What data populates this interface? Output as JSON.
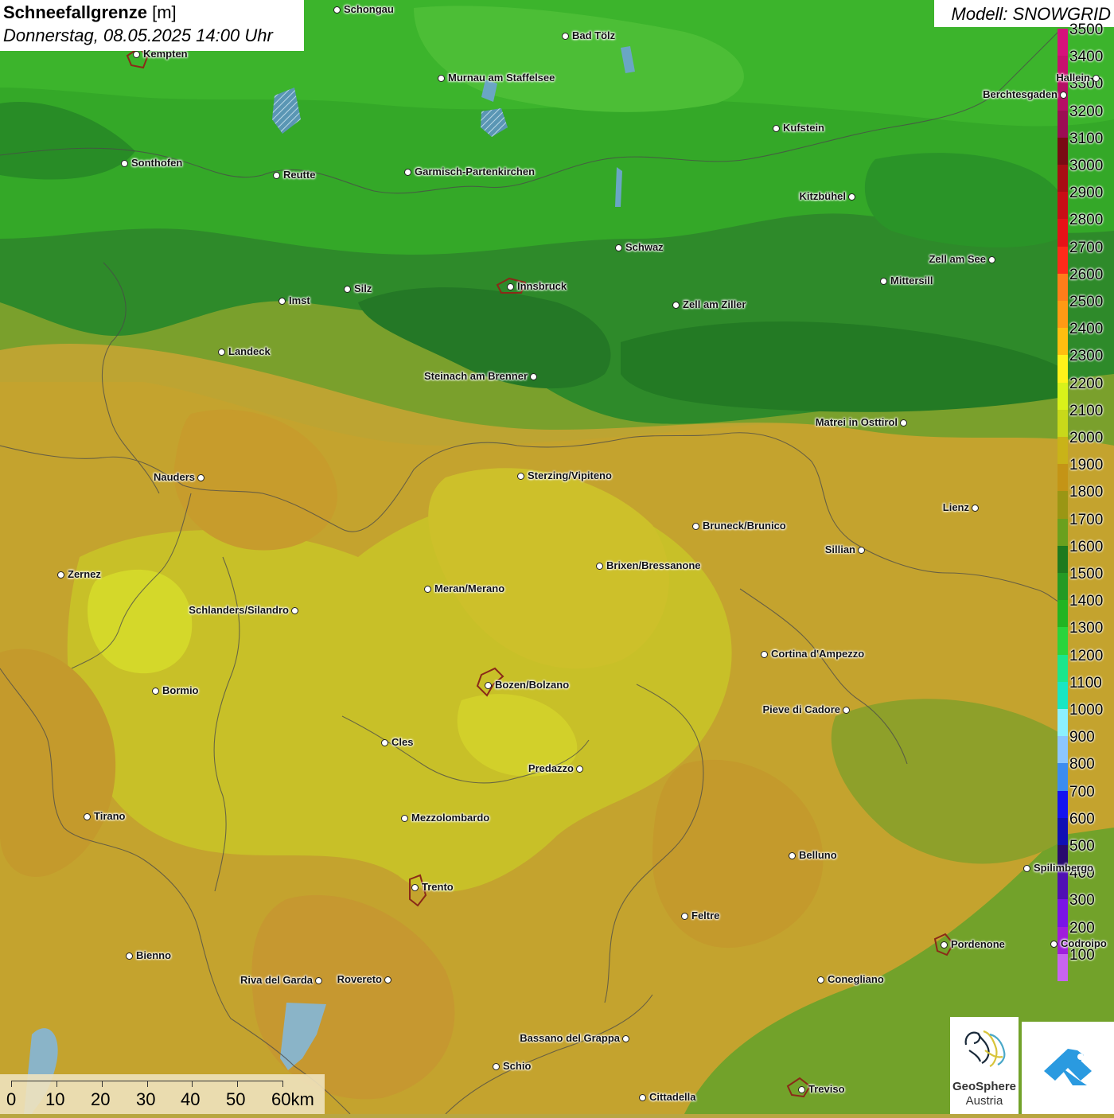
{
  "header": {
    "title": "Schneefallgrenze",
    "unit": "[m]",
    "datetime": "Donnerstag, 08.05.2025 14:00 Uhr",
    "model": "Modell: SNOWGRID"
  },
  "legend": [
    {
      "label": "3500",
      "color": "#d6127c"
    },
    {
      "label": "3400",
      "color": "#c7116f"
    },
    {
      "label": "3300",
      "color": "#b50f65"
    },
    {
      "label": "3200",
      "color": "#9c0d54"
    },
    {
      "label": "3100",
      "color": "#7a0a14"
    },
    {
      "label": "3000",
      "color": "#a80d14"
    },
    {
      "label": "2900",
      "color": "#c80e16"
    },
    {
      "label": "2800",
      "color": "#e61218"
    },
    {
      "label": "2700",
      "color": "#ff2a1a"
    },
    {
      "label": "2600",
      "color": "#ff7d1a"
    },
    {
      "label": "2500",
      "color": "#ff9a14"
    },
    {
      "label": "2400",
      "color": "#ffbe10"
    },
    {
      "label": "2300",
      "color": "#fff21a"
    },
    {
      "label": "2200",
      "color": "#d9f21a"
    },
    {
      "label": "2100",
      "color": "#c8d91a"
    },
    {
      "label": "2000",
      "color": "#c9b318"
    },
    {
      "label": "1900",
      "color": "#c49416"
    },
    {
      "label": "1800",
      "color": "#9a9614"
    },
    {
      "label": "1700",
      "color": "#6aa01e"
    },
    {
      "label": "1600",
      "color": "#1e7a1e"
    },
    {
      "label": "1500",
      "color": "#249a24"
    },
    {
      "label": "1400",
      "color": "#22b422"
    },
    {
      "label": "1300",
      "color": "#2ad43c"
    },
    {
      "label": "1200",
      "color": "#1ae68c"
    },
    {
      "label": "1100",
      "color": "#18e6c4"
    },
    {
      "label": "1000",
      "color": "#8cf0ff"
    },
    {
      "label": "900",
      "color": "#8cc6ff"
    },
    {
      "label": "800",
      "color": "#3c8cf0"
    },
    {
      "label": "700",
      "color": "#1414f0"
    },
    {
      "label": "600",
      "color": "#1010b4"
    },
    {
      "label": "500",
      "color": "#280a6e"
    },
    {
      "label": "400",
      "color": "#5010b4"
    },
    {
      "label": "300",
      "color": "#7a14e6"
    },
    {
      "label": "200",
      "color": "#a01edc"
    },
    {
      "label": "100",
      "color": "#c864f0"
    }
  ],
  "cities": [
    {
      "name": "Schongau",
      "side": "r"
    },
    {
      "name": "Bad Tölz",
      "side": "r"
    },
    {
      "name": "Kempten",
      "side": "r"
    },
    {
      "name": "Murnau am Staffelsee",
      "side": "r"
    },
    {
      "name": "Hallein",
      "side": "l"
    },
    {
      "name": "Berchtesgaden",
      "side": "l"
    },
    {
      "name": "Kufstein",
      "side": "r"
    },
    {
      "name": "Sonthofen",
      "side": "r"
    },
    {
      "name": "Reutte",
      "side": "r"
    },
    {
      "name": "Garmisch-Partenkirchen",
      "side": "r"
    },
    {
      "name": "Kitzbühel",
      "side": "l"
    },
    {
      "name": "Schwaz",
      "side": "r"
    },
    {
      "name": "Zell am See",
      "side": "l"
    },
    {
      "name": "Innsbruck",
      "side": "r"
    },
    {
      "name": "Mittersill",
      "side": "r"
    },
    {
      "name": "Silz",
      "side": "r"
    },
    {
      "name": "Imst",
      "side": "r"
    },
    {
      "name": "Zell am Ziller",
      "side": "r"
    },
    {
      "name": "Landeck",
      "side": "r"
    },
    {
      "name": "Steinach am Brenner",
      "side": "l"
    },
    {
      "name": "Matrei in Osttirol",
      "side": "l"
    },
    {
      "name": "Nauders",
      "side": "l"
    },
    {
      "name": "Sterzing/Vipiteno",
      "side": "r"
    },
    {
      "name": "Lienz",
      "side": "l"
    },
    {
      "name": "Bruneck/Brunico",
      "side": "r"
    },
    {
      "name": "Sillian",
      "side": "l"
    },
    {
      "name": "Brixen/Bressanone",
      "side": "r"
    },
    {
      "name": "Zernez",
      "side": "r"
    },
    {
      "name": "Meran/Merano",
      "side": "r"
    },
    {
      "name": "Schlanders/Silandro",
      "side": "l"
    },
    {
      "name": "Cortina d'Ampezzo",
      "side": "r"
    },
    {
      "name": "Bozen/Bolzano",
      "side": "r"
    },
    {
      "name": "Bormio",
      "side": "r"
    },
    {
      "name": "Pieve di Cadore",
      "side": "l"
    },
    {
      "name": "Cles",
      "side": "r"
    },
    {
      "name": "Predazzo",
      "side": "l"
    },
    {
      "name": "Tirano",
      "side": "r"
    },
    {
      "name": "Mezzolombardo",
      "side": "r"
    },
    {
      "name": "Belluno",
      "side": "r"
    },
    {
      "name": "Spilimbergo",
      "side": "r"
    },
    {
      "name": "Trento",
      "side": "r"
    },
    {
      "name": "Feltre",
      "side": "r"
    },
    {
      "name": "Pordenone",
      "side": "r"
    },
    {
      "name": "Codroipo",
      "side": "r"
    },
    {
      "name": "Bienno",
      "side": "r"
    },
    {
      "name": "Riva del Garda",
      "side": "l"
    },
    {
      "name": "Rovereto",
      "side": "l"
    },
    {
      "name": "Conegliano",
      "side": "r"
    },
    {
      "name": "Bassano del Grappa",
      "side": "l"
    },
    {
      "name": "Schio",
      "side": "r"
    },
    {
      "name": "Treviso",
      "side": "r"
    },
    {
      "name": "Cittadella",
      "side": "r"
    }
  ],
  "scalebar": [
    "0",
    "10",
    "20",
    "30",
    "40",
    "50",
    "60km"
  ],
  "logo": {
    "line1": "GeoSphere",
    "line2": "Austria"
  }
}
